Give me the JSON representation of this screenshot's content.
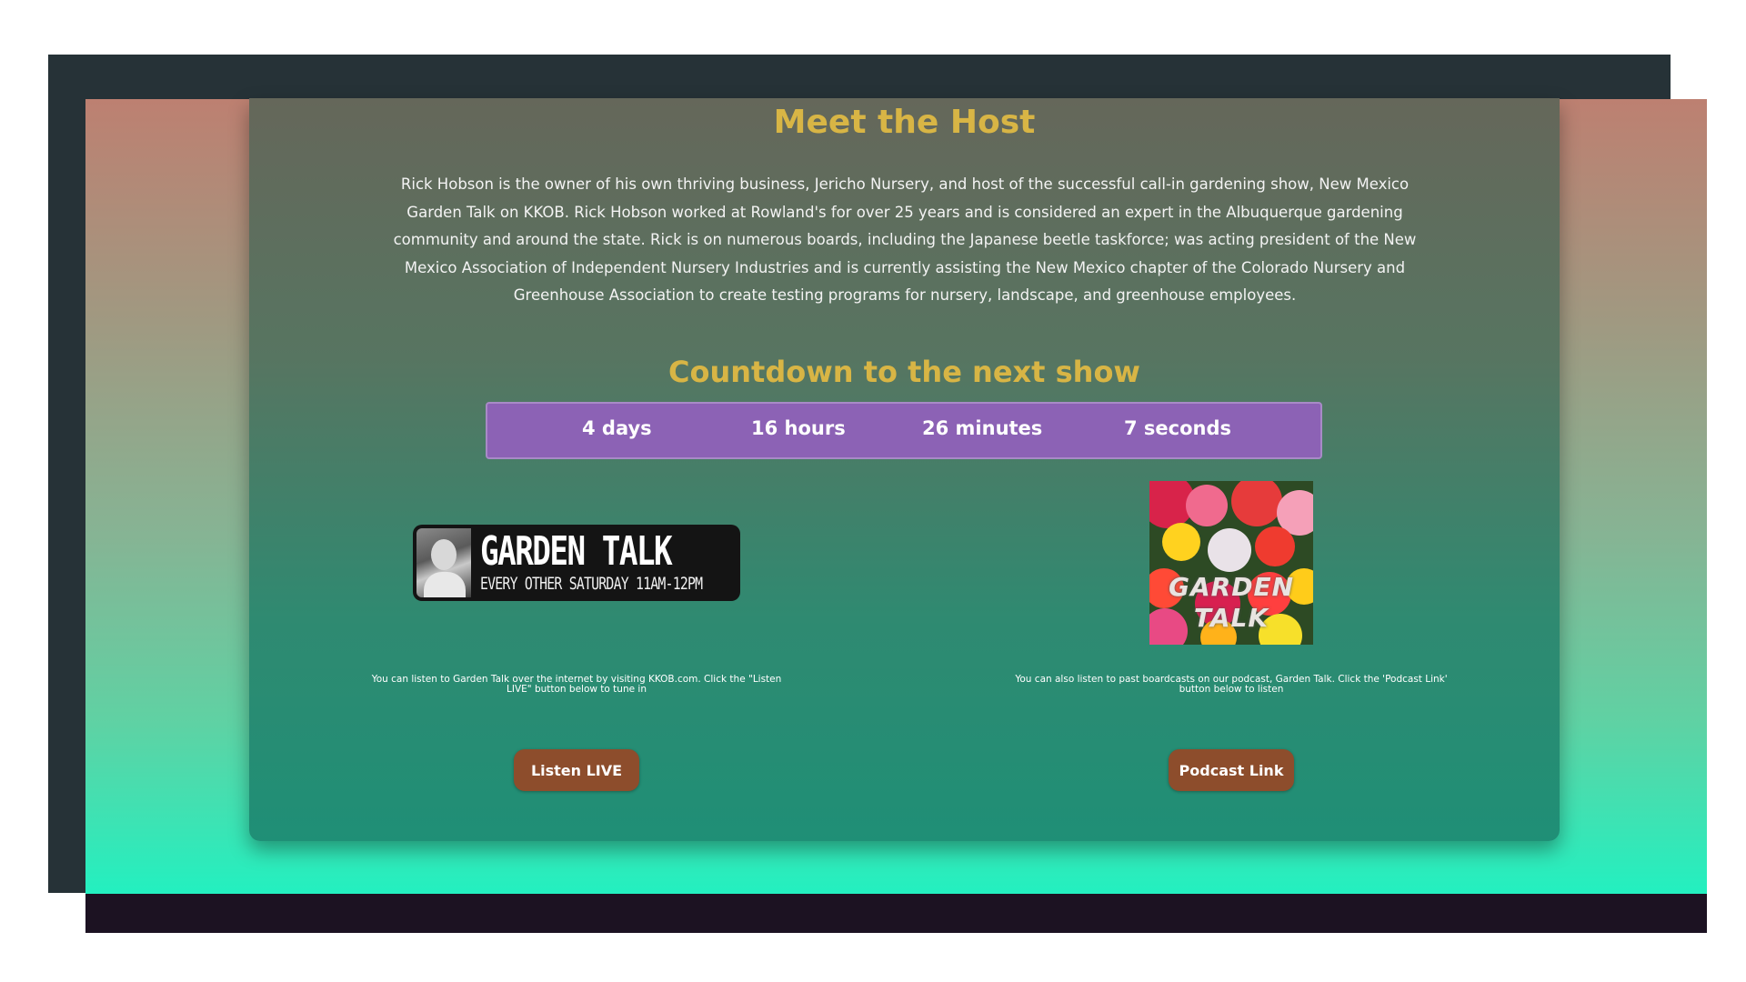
{
  "host": {
    "title": "Meet the Host",
    "bio": "Rick Hobson is the owner of his own thriving business, Jericho Nursery, and host of the successful call-in gardening show, New Mexico Garden Talk on KKOB. Rick Hobson worked at Rowland's for over 25 years and is considered an expert in the Albuquerque gardening community and around the state. Rick is on numerous boards, including the Japanese beetle taskforce; was acting president of the New Mexico Association of Independent Nursery Industries and is currently assisting the New Mexico chapter of the Colorado Nursery and Greenhouse Association to create testing programs for nursery, landscape, and greenhouse employees."
  },
  "countdown": {
    "title": "Countdown to the next show",
    "days": "4 days",
    "hours": "16 hours",
    "minutes": "26 minutes",
    "seconds": "7 seconds"
  },
  "listen": {
    "banner_title": "GARDEN TALK",
    "banner_subtitle": "EVERY OTHER SATURDAY 11AM-12PM",
    "note": "You can listen to Garden Talk over the internet by visiting KKOB.com. Click the \"Listen LIVE\" button below to tune in",
    "button_label": "Listen LIVE"
  },
  "podcast": {
    "art_text_line1": "GARDEN",
    "art_text_line2": "TALK",
    "note": "You can also listen to past boardcasts on our podcast, Garden Talk. Click the 'Podcast Link' button below to listen",
    "button_label": "Podcast Link"
  },
  "colors": {
    "heading_gold": "#d8b545",
    "countdown_purple": "#8c62b5",
    "button_brown": "#8d4d2c"
  }
}
